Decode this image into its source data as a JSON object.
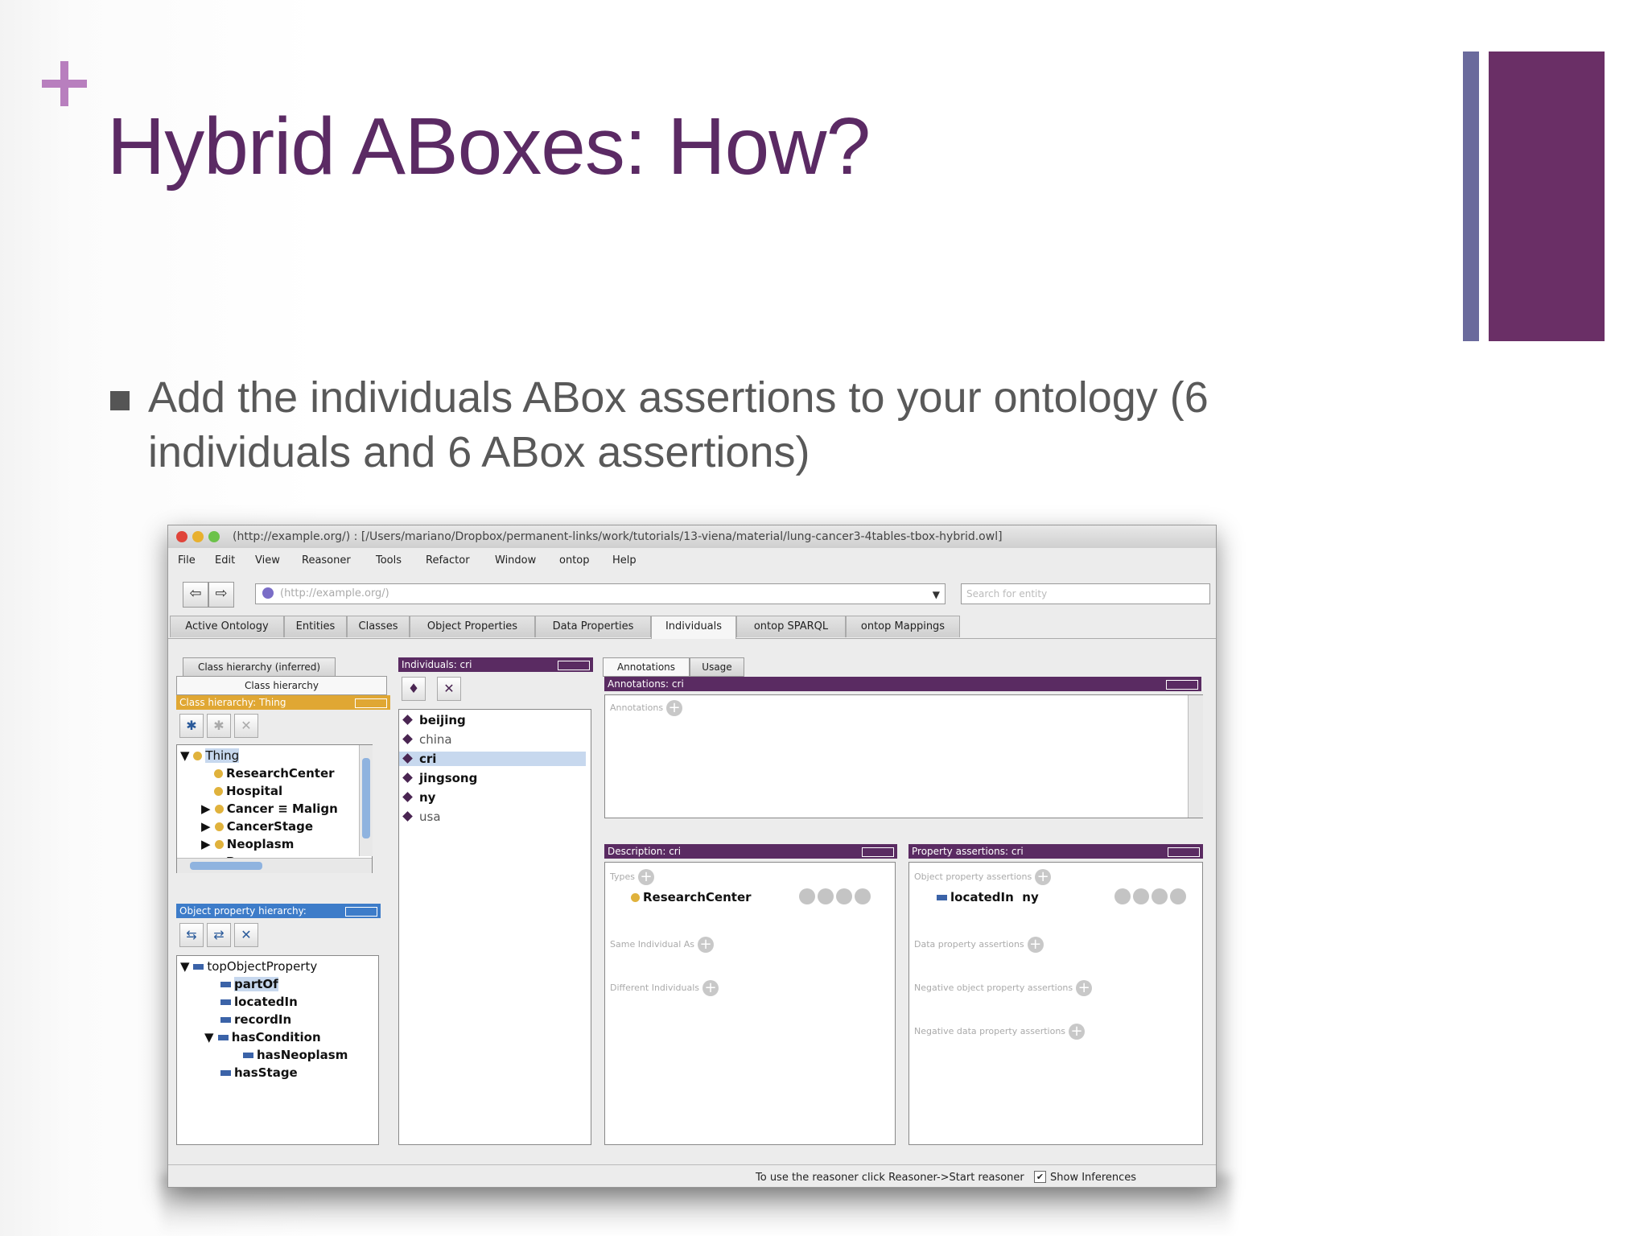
{
  "slide": {
    "title": "Hybrid ABoxes: How?",
    "bullet": "Add the individuals ABox assertions to your ontology (6 individuals and 6 ABox assertions)"
  },
  "window": {
    "title": "(http://example.org/) : [/Users/mariano/Dropbox/permanent-links/work/tutorials/13-viena/material/lung-cancer3-4tables-tbox-hybrid.owl]",
    "menu": [
      "File",
      "Edit",
      "View",
      "Reasoner",
      "Tools",
      "Refactor",
      "Window",
      "ontop",
      "Help"
    ],
    "url": "(http://example.org/)",
    "search_placeholder": "Search for entity",
    "tabs": [
      "Active Ontology",
      "Entities",
      "Classes",
      "Object Properties",
      "Data Properties",
      "Individuals",
      "ontop SPARQL",
      "ontop Mappings"
    ],
    "active_tab": "Individuals"
  },
  "class_panel": {
    "tab_inferred": "Class hierarchy (inferred)",
    "tab_hierarchy": "Class hierarchy",
    "header": "Class hierarchy: Thing",
    "items": [
      "Thing",
      "ResearchCenter",
      "Hospital",
      "Cancer ≡ Malign",
      "CancerStage",
      "Neoplasm",
      "Person"
    ]
  },
  "objprop_panel": {
    "header": "Object property hierarchy:",
    "items": [
      "topObjectProperty",
      "partOf",
      "locatedIn",
      "recordIn",
      "hasCondition",
      "hasNeoplasm",
      "hasStage"
    ]
  },
  "individuals_panel": {
    "header": "Individuals: cri",
    "items": [
      "beijing",
      "china",
      "cri",
      "jingsong",
      "ny",
      "usa"
    ],
    "selected": "cri"
  },
  "annotations_panel": {
    "tab_annotations": "Annotations",
    "tab_usage": "Usage",
    "header": "Annotations: cri",
    "label": "Annotations"
  },
  "description_panel": {
    "header": "Description: cri",
    "types_label": "Types",
    "type_value": "ResearchCenter",
    "same_label": "Same Individual As",
    "different_label": "Different Individuals"
  },
  "property_panel": {
    "header": "Property assertions: cri",
    "obj_label": "Object property assertions",
    "obj_property": "locatedIn",
    "obj_value": "ny",
    "data_label": "Data property assertions",
    "neg_obj_label": "Negative object property assertions",
    "neg_data_label": "Negative data property assertions"
  },
  "status": {
    "text": "To use the reasoner click Reasoner->Start reasoner",
    "show_inferences": "Show Inferences"
  },
  "colors": {
    "title": "#5b2a64",
    "accent_bar": "#6a2f66",
    "accent_bar_thin": "#6a6a9c",
    "plus": "#b87fbe",
    "panel_header": "#5a2b62"
  }
}
